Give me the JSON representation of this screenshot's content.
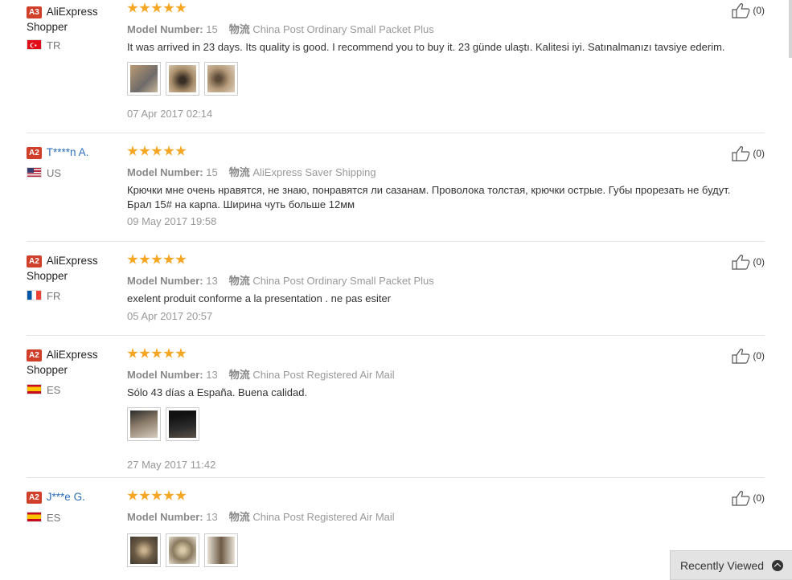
{
  "reviews": [
    {
      "badge": "A3",
      "name_line1": "AliExpress",
      "name_line2": "Shopper",
      "country": "TR",
      "model_label": "Model Number:",
      "model_value": "15",
      "logistics_label": "物流",
      "shipping": "China Post Ordinary Small Packet Plus",
      "text": "It was arrived in 23 days. Its quality is good. I recommend you to buy it. 23 günde ulaştı. Kalitesi iyi. Satınalmanızı tavsiye ederim.",
      "date": "07 Apr 2017 02:14",
      "helpful": "(0)",
      "photos": 3
    },
    {
      "badge": "A2",
      "name_line1": "T****n A.",
      "country": "US",
      "model_label": "Model Number:",
      "model_value": "15",
      "logistics_label": "物流",
      "shipping": "AliExpress Saver Shipping",
      "text": "Крючки мне очень нравятся, не знаю, понравятся ли сазанам. Проволока толстая, крючки острые. Губы прорезать не будут. Брал 15# на карпа. Ширина чуть больше 12мм",
      "date": "09 May 2017 19:58",
      "helpful": "(0)",
      "photos": 0
    },
    {
      "badge": "A2",
      "name_line1": "AliExpress",
      "name_line2": "Shopper",
      "country": "FR",
      "model_label": "Model Number:",
      "model_value": "13",
      "logistics_label": "物流",
      "shipping": "China Post Ordinary Small Packet Plus",
      "text": "exelent produit conforme a la presentation . ne pas esiter",
      "date": "05 Apr 2017 20:57",
      "helpful": "(0)",
      "photos": 0
    },
    {
      "badge": "A2",
      "name_line1": "AliExpress",
      "name_line2": "Shopper",
      "country": "ES",
      "model_label": "Model Number:",
      "model_value": "13",
      "logistics_label": "物流",
      "shipping": "China Post Registered Air Mail",
      "text": "Sólo 43 días a España. Buena calidad.",
      "date": "27 May 2017 11:42",
      "helpful": "(0)",
      "photos": 2
    },
    {
      "badge": "A2",
      "name_line1": "J***e G.",
      "country": "ES",
      "model_label": "Model Number:",
      "model_value": "13",
      "logistics_label": "物流",
      "shipping": "China Post Registered Air Mail",
      "text": "",
      "date": "",
      "helpful": "(0)",
      "photos": 3
    }
  ],
  "recently_viewed": {
    "label": "Recently Viewed",
    "icon": "chevron-up-circle-icon"
  },
  "colors": {
    "star": "#f5a623",
    "badge": "#d03f2a",
    "link": "#2a6ebb"
  }
}
